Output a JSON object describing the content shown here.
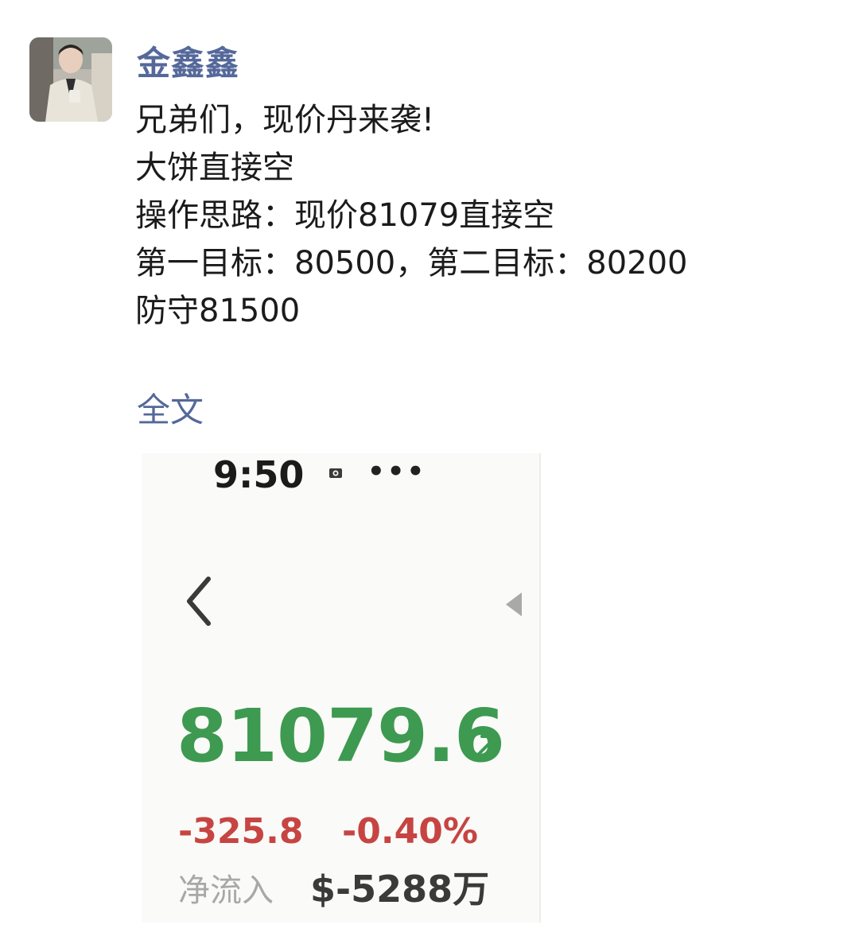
{
  "post": {
    "author": "金鑫鑫",
    "lines": [
      "兄弟们，现价丹来袭!",
      "大饼直接空",
      "操作思路：现价81079直接空",
      "第一目标：80500，第二目标：80200",
      "防守81500"
    ],
    "full_text_link": "全文"
  },
  "screenshot": {
    "time": "9:50",
    "more": "•••",
    "price": "81079.6",
    "change": "-325.8",
    "change_pct": "-0.40%",
    "net_inflow_label": "净流入",
    "net_inflow_value": "$-5288万",
    "colors": {
      "price": "#3d9a50",
      "change": "#c64542"
    },
    "icons": [
      "status-camera-icon",
      "back-chevron-icon",
      "side-arrow-icon",
      "trend-up-right-icon"
    ]
  },
  "colors": {
    "author": "#55689a",
    "link": "#55689a",
    "text": "#1b1b1b"
  }
}
